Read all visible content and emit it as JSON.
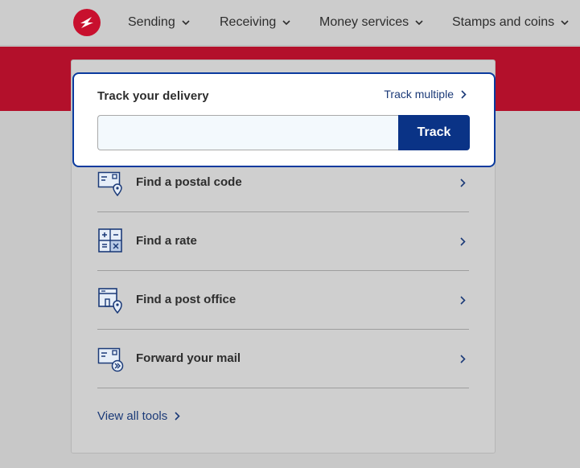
{
  "nav": {
    "logo_icon": "canada-post-logo-icon",
    "items": [
      {
        "label": "Sending"
      },
      {
        "label": "Receiving"
      },
      {
        "label": "Money services"
      },
      {
        "label": "Stamps and coins"
      }
    ]
  },
  "track": {
    "title": "Track your delivery",
    "multiple_label": "Track multiple",
    "input_value": "",
    "input_placeholder": "",
    "button_label": "Track"
  },
  "tools": [
    {
      "label": "Find a postal code",
      "icon": "postal-code-icon"
    },
    {
      "label": "Find a rate",
      "icon": "calculator-icon"
    },
    {
      "label": "Find a post office",
      "icon": "post-office-icon"
    },
    {
      "label": "Forward your mail",
      "icon": "forward-mail-icon"
    }
  ],
  "view_all": "View all tools",
  "colors": {
    "brand_red": "#c8102e",
    "primary_blue": "#0a3386",
    "link_blue": "#1b3a78"
  }
}
